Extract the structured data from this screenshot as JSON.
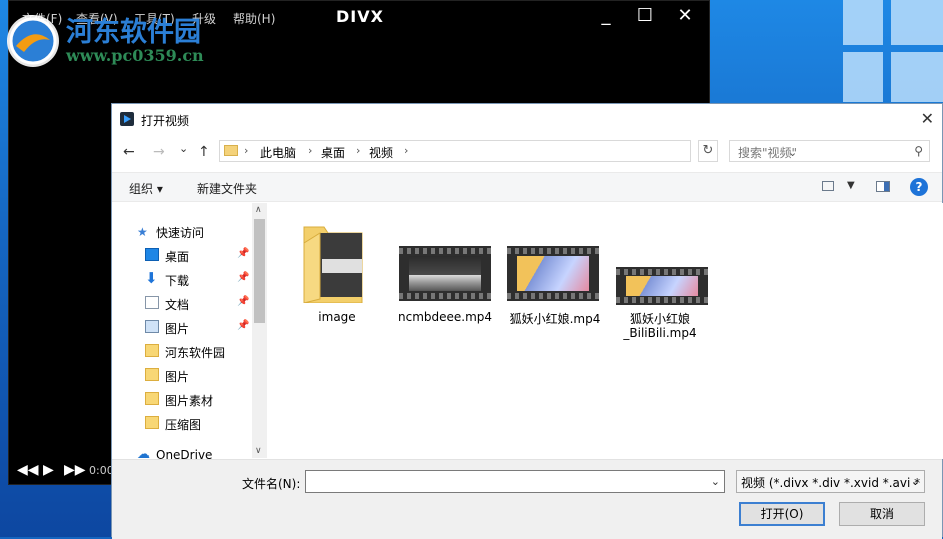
{
  "player": {
    "menu": [
      "文件(F)",
      "查看(V)",
      "工具(T)",
      "升级",
      "帮助(H)"
    ],
    "logo": "DIVX",
    "window_buttons": [
      "_",
      "☐",
      "✕"
    ],
    "time": "0:00"
  },
  "watermark": {
    "title": "河东软件园",
    "url": "www.pc0359.cn"
  },
  "dialog": {
    "title": "打开视频",
    "nav": {
      "back": "←",
      "forward": "→",
      "recent": "⌄",
      "up": "↑",
      "breadcrumbs": [
        "此电脑",
        "桌面",
        "视频"
      ],
      "refresh": "↻",
      "search_placeholder": "搜索\"视频\"",
      "search_icon": "⚲"
    },
    "toolbar": {
      "organize": "组织 ▾",
      "new_folder": "新建文件夹",
      "help": "?"
    },
    "sidebar": {
      "quick_access": "快速访问",
      "items": [
        {
          "label": "桌面",
          "pinned": true
        },
        {
          "label": "下载",
          "pinned": true
        },
        {
          "label": "文档",
          "pinned": true
        },
        {
          "label": "图片",
          "pinned": true
        },
        {
          "label": "河东软件园",
          "pinned": false
        },
        {
          "label": "图片",
          "pinned": false
        },
        {
          "label": "图片素材",
          "pinned": false
        },
        {
          "label": "压缩图",
          "pinned": false
        }
      ],
      "onedrive": "OneDrive",
      "pin_glyph": "📌"
    },
    "files": [
      {
        "name": "image",
        "type": "folder"
      },
      {
        "name": "ncmbdeee.mp4",
        "type": "video"
      },
      {
        "name": "狐妖小红娘.mp4",
        "type": "video"
      },
      {
        "name_line1": "狐妖小红娘",
        "name_line2": "_BiliBili.mp4",
        "type": "video"
      }
    ],
    "bottom": {
      "filename_label": "文件名(N):",
      "filename_value": "",
      "filetype": "视频 (*.divx *.div *.xvid *.avi *",
      "open_button": "打开(O)",
      "cancel_button": "取消"
    }
  },
  "colors": {
    "accent": "#3c7fd1",
    "folder": "#f8d775",
    "watermark_blue": "#2b7fd6",
    "watermark_green": "#2e8b57"
  }
}
